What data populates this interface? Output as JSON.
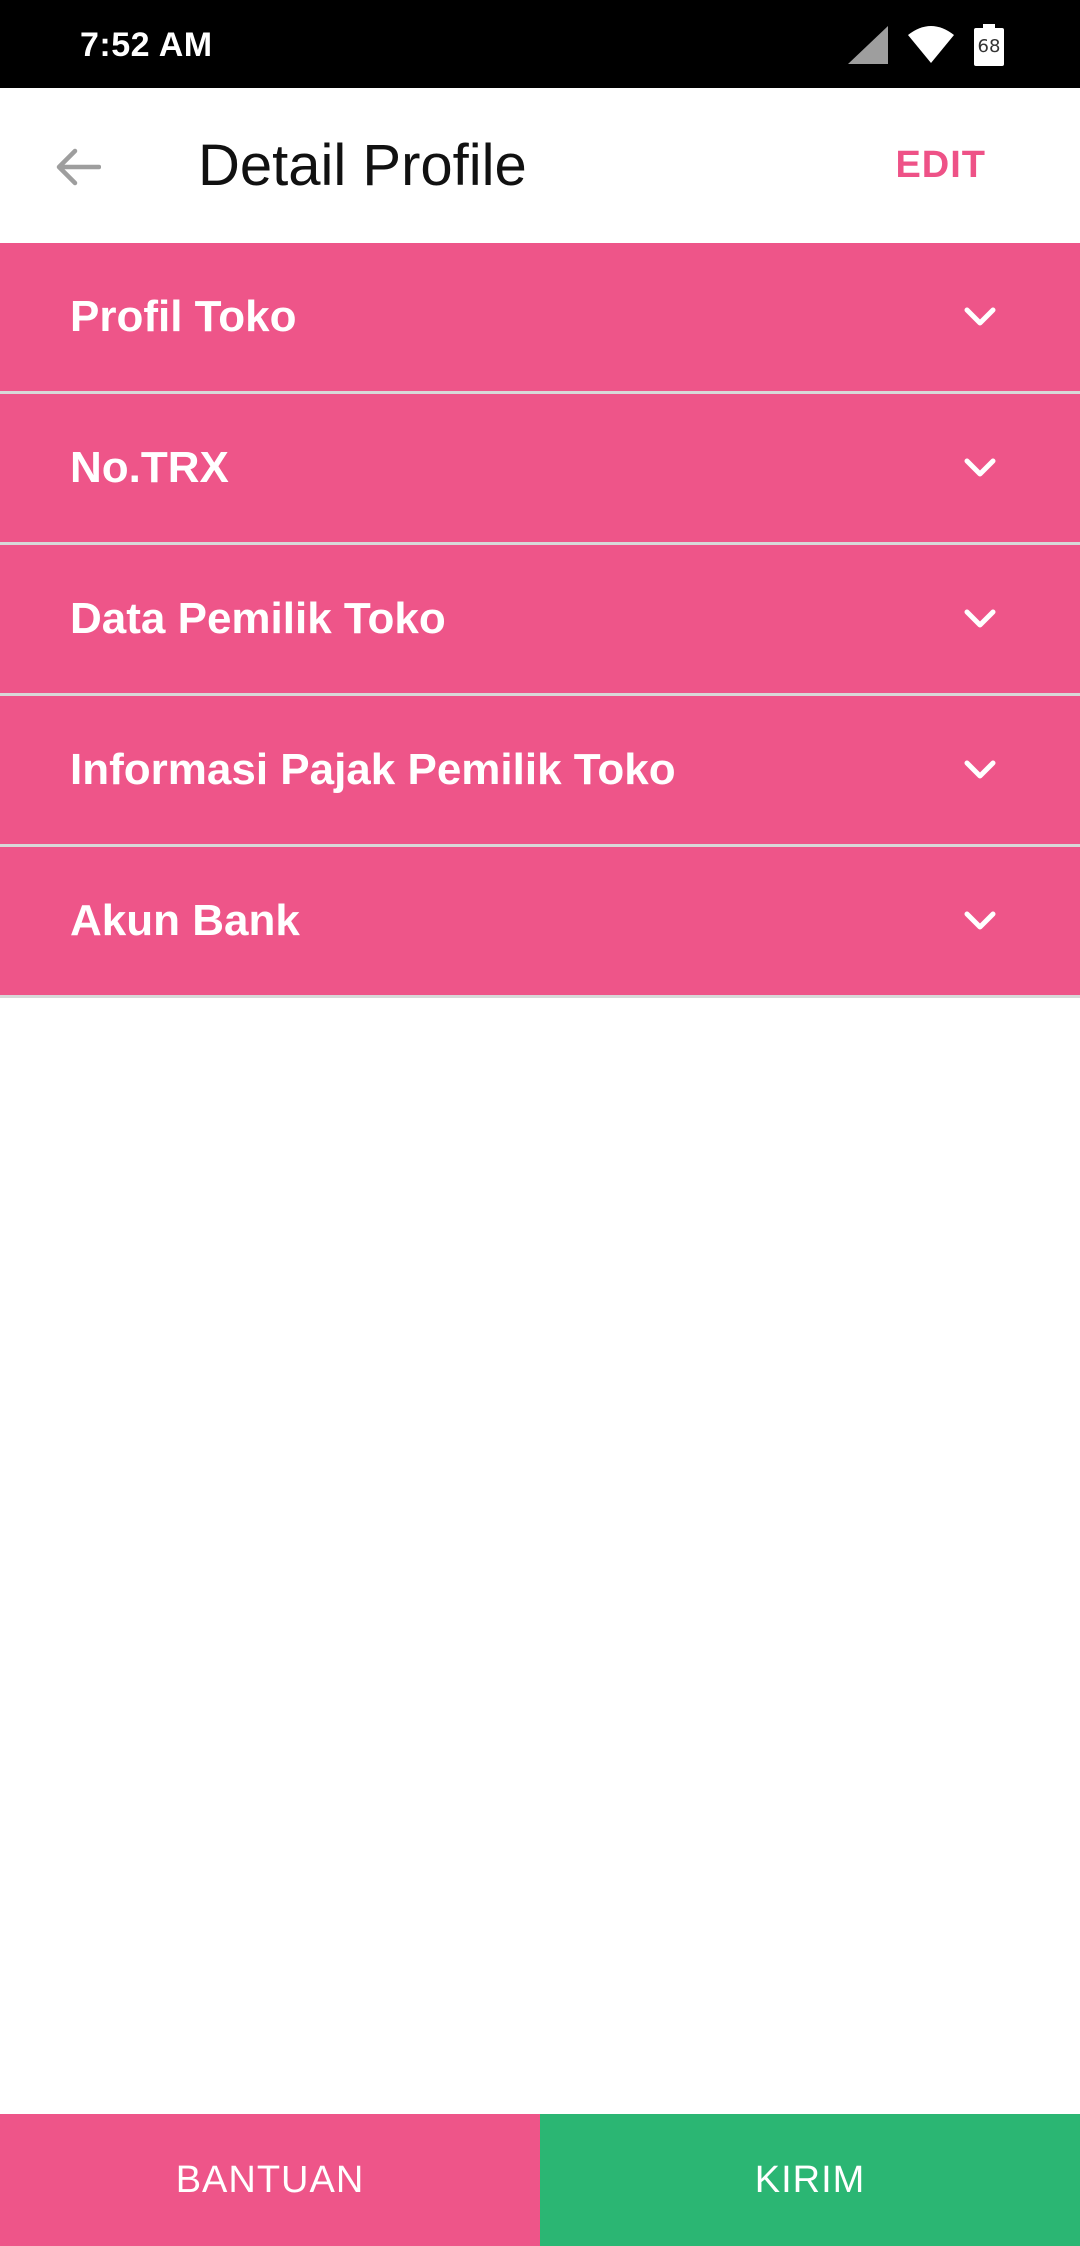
{
  "status_bar": {
    "time": "7:52 AM",
    "battery_level": "68",
    "icons": [
      "signal-icon",
      "wifi-icon",
      "battery-icon"
    ]
  },
  "app_bar": {
    "title": "Detail Profile",
    "edit_label": "EDIT",
    "back_icon": "arrow-left-icon"
  },
  "sections": [
    {
      "label": "Profil Toko"
    },
    {
      "label": "No.TRX"
    },
    {
      "label": "Data Pemilik Toko"
    },
    {
      "label": "Informasi Pajak Pemilik Toko"
    },
    {
      "label": "Akun Bank"
    }
  ],
  "bottom": {
    "help_label": "BANTUAN",
    "submit_label": "KIRIM"
  },
  "colors": {
    "primary": "#ee5589",
    "accent_text": "#ee5287",
    "submit": "#2bb673",
    "status_bar": "#000000"
  }
}
